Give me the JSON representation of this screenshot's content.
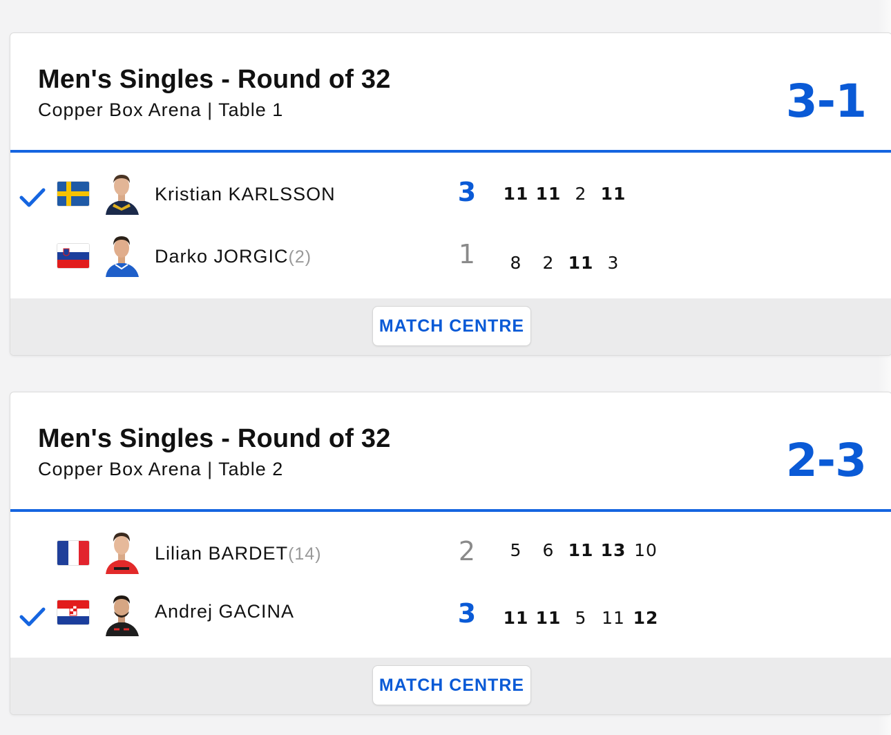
{
  "colors": {
    "accent": "#0a5ad6",
    "divider": "#1565e0",
    "muted": "#8a8a8a"
  },
  "matches": [
    {
      "title": "Men's Singles - Round of 32",
      "venue": "Copper Box Arena | Table 1",
      "score": "3-1",
      "players": [
        {
          "name": "Kristian KARLSSON",
          "seed": "",
          "country_flag": "sweden-flag",
          "winner": true,
          "sets_won": "3",
          "games": [
            "11",
            "11",
            "2",
            "11"
          ],
          "game_won": [
            true,
            true,
            false,
            true
          ]
        },
        {
          "name": "Darko JORGIC",
          "seed": "(2)",
          "country_flag": "slovenia-flag",
          "winner": false,
          "sets_won": "1",
          "games": [
            "8",
            "2",
            "11",
            "3"
          ],
          "game_won": [
            false,
            false,
            true,
            false
          ]
        }
      ],
      "button_label": "MATCH CENTRE"
    },
    {
      "title": "Men's Singles - Round of 32",
      "venue": "Copper Box Arena | Table 2",
      "score": "2-3",
      "players": [
        {
          "name": "Lilian BARDET",
          "seed": "(14)",
          "country_flag": "france-flag",
          "winner": false,
          "sets_won": "2",
          "games": [
            "5",
            "6",
            "11",
            "13",
            "10"
          ],
          "game_won": [
            false,
            false,
            true,
            true,
            false
          ]
        },
        {
          "name": "Andrej GACINA",
          "seed": "",
          "country_flag": "croatia-flag",
          "winner": true,
          "sets_won": "3",
          "games": [
            "11",
            "11",
            "5",
            "11",
            "12"
          ],
          "game_won": [
            true,
            true,
            false,
            false,
            true
          ]
        }
      ],
      "button_label": "MATCH CENTRE"
    }
  ]
}
